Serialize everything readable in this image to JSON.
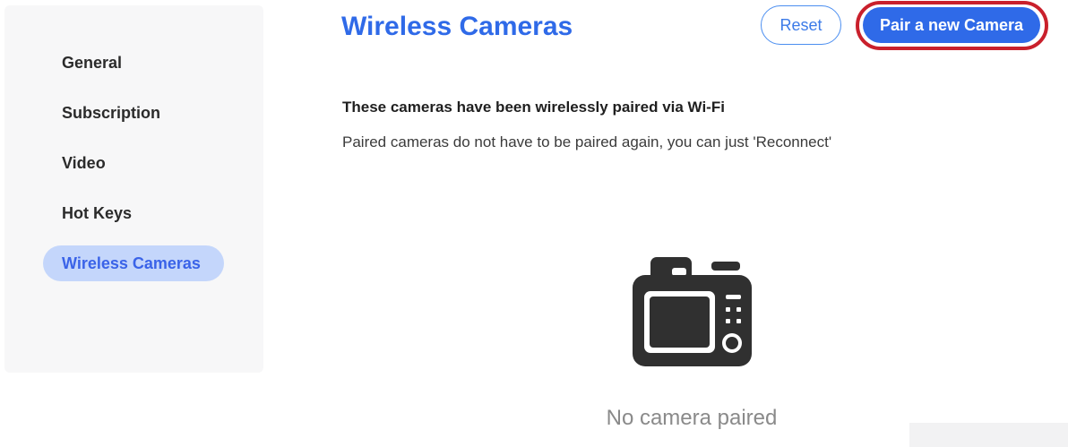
{
  "sidebar": {
    "items": [
      {
        "label": "General",
        "active": false
      },
      {
        "label": "Subscription",
        "active": false
      },
      {
        "label": "Video",
        "active": false
      },
      {
        "label": "Hot Keys",
        "active": false
      },
      {
        "label": "Wireless Cameras",
        "active": true
      }
    ]
  },
  "header": {
    "title": "Wireless Cameras",
    "reset_label": "Reset",
    "pair_label": "Pair a new Camera"
  },
  "main": {
    "heading": "These cameras have been wirelessly paired via Wi-Fi",
    "description": "Paired cameras do not have to be paired again, you can just 'Reconnect'",
    "empty_state": {
      "icon": "camera-icon",
      "text": "No camera paired"
    }
  },
  "colors": {
    "accent": "#2f6ae8",
    "active_item_bg": "#c4d6fb",
    "highlight_ring": "#c9202c",
    "icon": "#303030"
  }
}
